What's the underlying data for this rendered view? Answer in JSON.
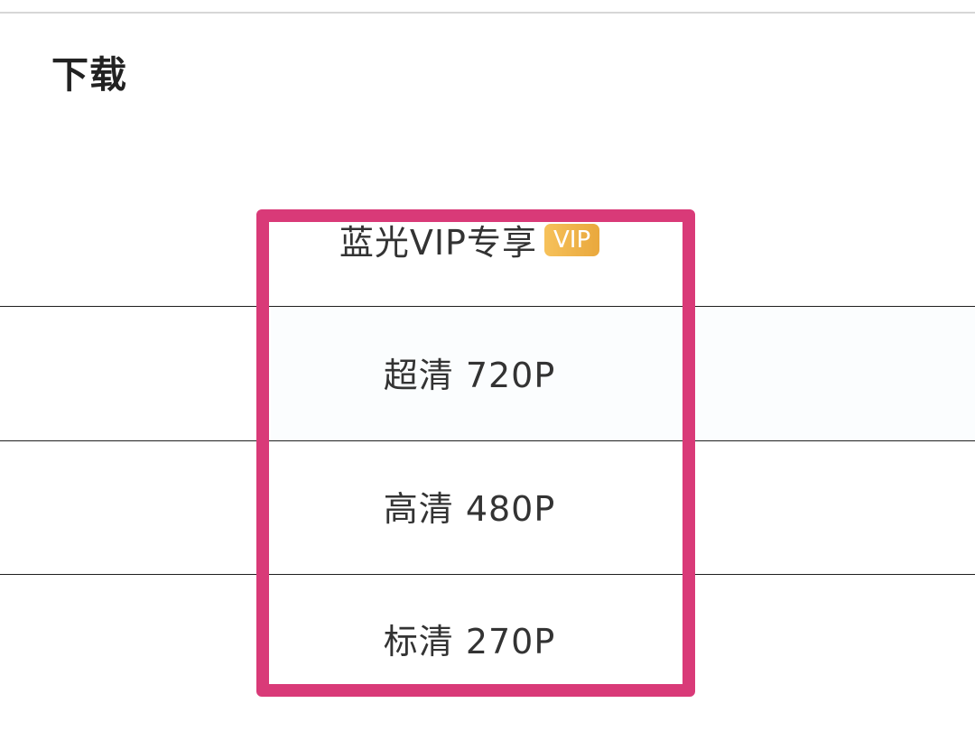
{
  "header": {
    "title": "下载"
  },
  "quality_options": [
    {
      "label": "蓝光VIP专享",
      "badge": "VIP"
    },
    {
      "label": "超清 720P"
    },
    {
      "label": "高清 480P"
    },
    {
      "label": "标清 270P"
    }
  ],
  "colors": {
    "highlight": "#d93a78",
    "vip_badge": "#f0b44a",
    "text": "#333333"
  }
}
